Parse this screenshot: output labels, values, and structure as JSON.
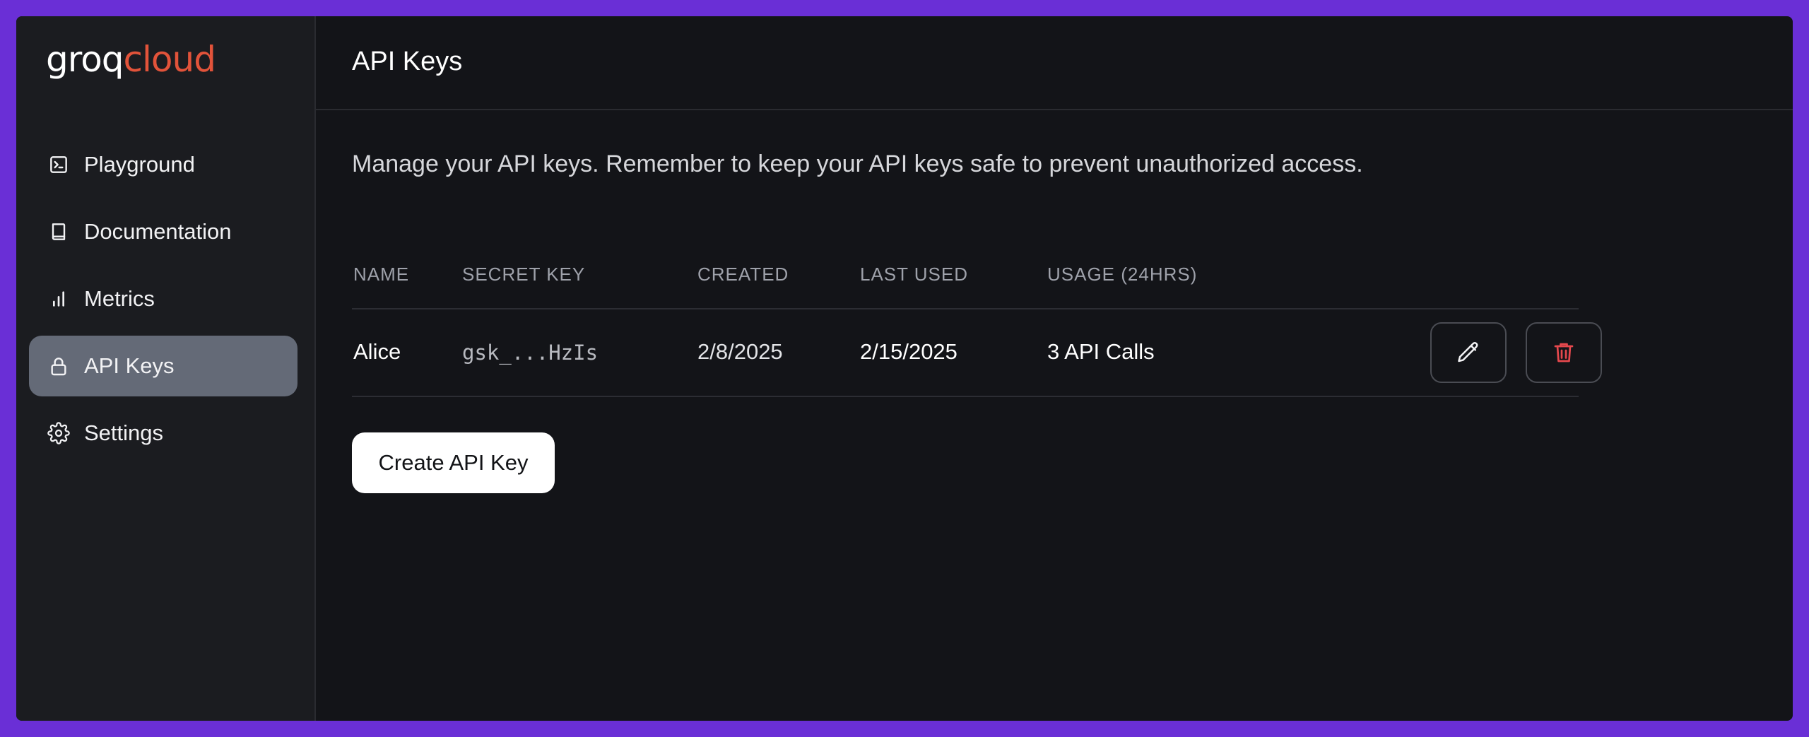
{
  "brand": {
    "logo_primary": "groq",
    "logo_secondary": "cloud",
    "primary_color": "#ffffff",
    "accent_color": "#e2533a"
  },
  "sidebar": {
    "items": [
      {
        "label": "Playground",
        "icon": "terminal-icon",
        "active": false
      },
      {
        "label": "Documentation",
        "icon": "book-icon",
        "active": false
      },
      {
        "label": "Metrics",
        "icon": "bar-chart-icon",
        "active": false
      },
      {
        "label": "API Keys",
        "icon": "lock-icon",
        "active": true
      },
      {
        "label": "Settings",
        "icon": "gear-icon",
        "active": false
      }
    ]
  },
  "header": {
    "title": "API Keys"
  },
  "main": {
    "description": "Manage your API keys. Remember to keep your API keys safe to prevent unauthorized access.",
    "table": {
      "columns": [
        "NAME",
        "SECRET KEY",
        "CREATED",
        "LAST USED",
        "USAGE (24HRS)"
      ],
      "rows": [
        {
          "name": "Alice",
          "secret_key": "gsk_...HzIs",
          "created": "2/8/2025",
          "last_used": "2/15/2025",
          "usage": "3 API Calls",
          "actions": [
            "pencil-icon",
            "trash-icon"
          ]
        }
      ]
    },
    "create_button_label": "Create API Key"
  },
  "colors": {
    "background_frame": "#6a2fd6",
    "window": "#131418",
    "sidebar": "#1b1c20",
    "active_nav": "#646a77",
    "delete_icon": "#e5484d"
  }
}
